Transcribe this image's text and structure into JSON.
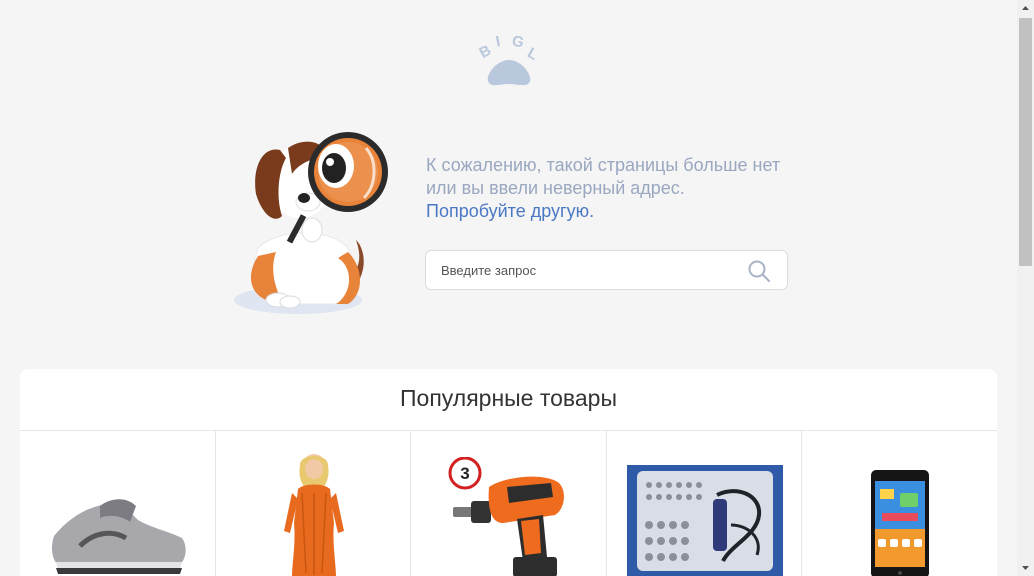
{
  "logo": {
    "text": "BIGL",
    "icon": "paw-icon",
    "color": "#b9c8dc"
  },
  "error": {
    "line1": "К сожалению, такой страницы больше нет",
    "line2": "или вы ввели неверный адрес.",
    "link": "Попробуйте другую."
  },
  "search": {
    "placeholder": "Введите запрос",
    "value": "",
    "icon": "search-icon"
  },
  "popular": {
    "title": "Популярные товары",
    "products": [
      {
        "icon": "sneakers-image"
      },
      {
        "icon": "orange-dress-image"
      },
      {
        "icon": "drill-image",
        "badge": "3"
      },
      {
        "icon": "tool-kit-image"
      },
      {
        "icon": "smartphone-image"
      }
    ]
  },
  "colors": {
    "background": "#f5f5f5",
    "message": "#9aa7c0",
    "link": "#4a78c4",
    "panel": "#ffffff"
  }
}
